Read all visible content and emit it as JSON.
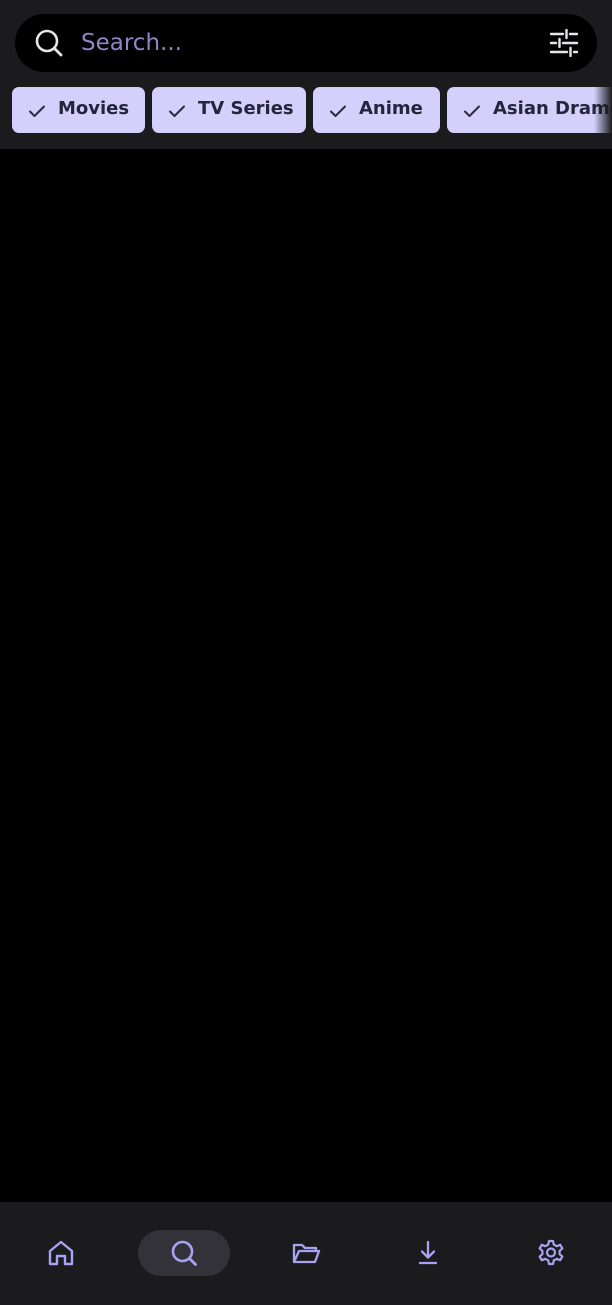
{
  "search": {
    "placeholder": "Search...",
    "value": "",
    "icon": "search-icon",
    "filter_icon": "sliders-icon"
  },
  "chips": [
    {
      "label": "Movies",
      "selected": true,
      "icon": "check-icon"
    },
    {
      "label": "TV Series",
      "selected": true,
      "icon": "check-icon"
    },
    {
      "label": "Anime",
      "selected": true,
      "icon": "check-icon"
    },
    {
      "label": "Asian Drama",
      "selected": true,
      "icon": "check-icon"
    }
  ],
  "nav": {
    "items": [
      {
        "icon": "home-icon",
        "active": false
      },
      {
        "icon": "search-icon",
        "active": true
      },
      {
        "icon": "folder-open-icon",
        "active": false
      },
      {
        "icon": "download-icon",
        "active": false
      },
      {
        "icon": "settings-gear-icon",
        "active": false
      }
    ]
  },
  "colors": {
    "background": "#000000",
    "surface": "#1b1b1d",
    "chip_background": "#d4d0fb",
    "chip_text": "#26243a",
    "accent": "#a9a2f2",
    "placeholder": "#8f86c6",
    "nav_active": "#333238"
  }
}
